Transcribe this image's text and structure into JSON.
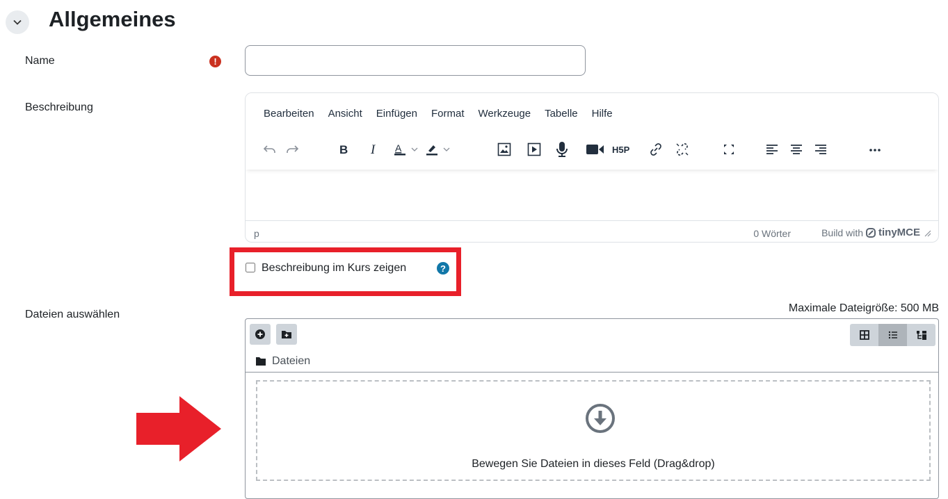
{
  "section": {
    "title": "Allgemeines"
  },
  "name_field": {
    "label": "Name",
    "value": "",
    "required_icon": "exclamation-icon"
  },
  "description": {
    "label": "Beschreibung",
    "menu": [
      "Bearbeiten",
      "Ansicht",
      "Einfügen",
      "Format",
      "Werkzeuge",
      "Tabelle",
      "Hilfe"
    ],
    "toolbar_icons": [
      "undo-icon",
      "redo-icon",
      "bold-icon",
      "italic-icon",
      "text-color-icon",
      "highlight-color-icon",
      "image-icon",
      "media-icon",
      "microphone-icon",
      "video-icon",
      "h5p-icon",
      "link-icon",
      "unlink-icon",
      "fullscreen-icon",
      "align-left-icon",
      "align-center-icon",
      "align-right-icon",
      "more-icon"
    ],
    "footer_path": "p",
    "word_count": "0 Wörter",
    "build_with": "Build with",
    "brand": "tinyMCE"
  },
  "show_description": {
    "label": "Beschreibung im Kurs zeigen",
    "checked": false
  },
  "files": {
    "label": "Dateien auswählen",
    "max_size": "Maximale Dateigröße: 500 MB",
    "folder": "Dateien",
    "drop_text": "Bewegen Sie Dateien in dieses Feld (Drag&drop)"
  },
  "colors": {
    "annotation_red": "#e8202a",
    "required_red": "#ca3120",
    "help_blue": "#1177a8"
  }
}
